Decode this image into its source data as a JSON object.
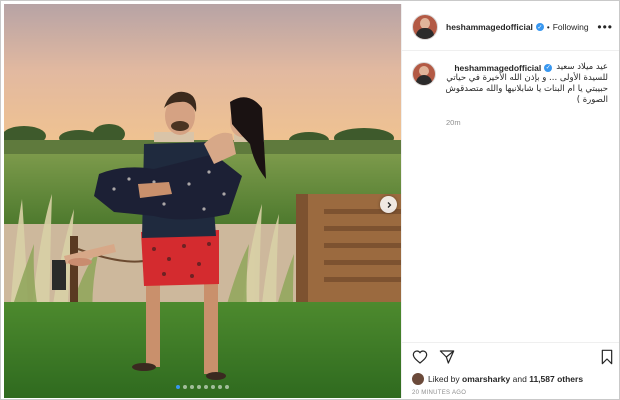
{
  "post": {
    "username": "heshammagedofficial",
    "following_label": "Following",
    "separator": "•",
    "more_label": "•••",
    "caption_lines": [
      "عيد ميلاد سعيد",
      "للسيدة الأولى ... و بإذن الله الأخيرة في حياتي",
      "حبيبتي يا ام البنات يا شابلانيها والله متصدقوش",
      "الصورة )"
    ],
    "caption_age": "20m",
    "liked_prefix": "Liked by",
    "liked_user": "omarsharky",
    "liked_and": "and",
    "liked_others": "11,587 others",
    "posted_time": "20 MINUTES AGO"
  },
  "carousel": {
    "count": 8,
    "active_index": 0
  },
  "colors": {
    "verified": "#3897f0",
    "active_dot": "#3897f0",
    "muted": "#8e8e8e",
    "text": "#262626"
  },
  "icons": {
    "verified": "verified-badge-icon",
    "next": "chevron-right-icon",
    "like": "heart-icon",
    "share": "paper-plane-icon",
    "save": "bookmark-icon",
    "more": "ellipsis-icon"
  }
}
